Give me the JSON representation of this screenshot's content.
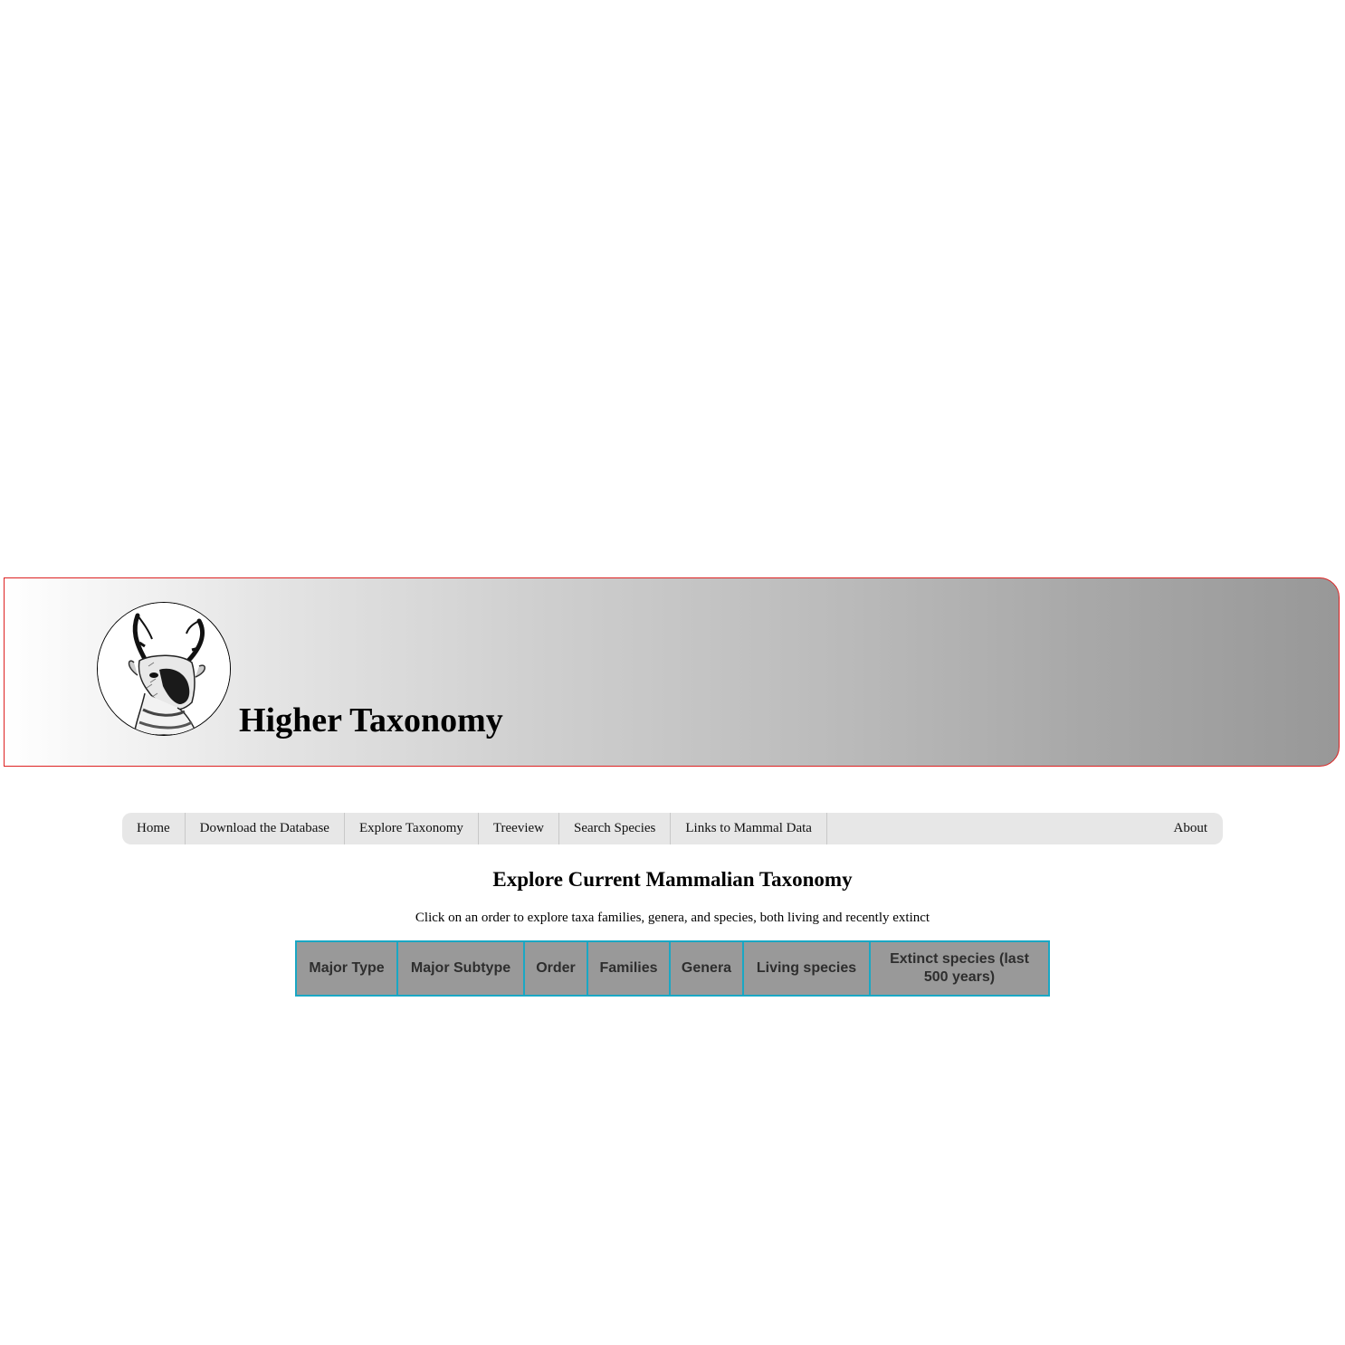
{
  "header": {
    "title": "Higher Taxonomy",
    "logo_icon": "pronghorn-antelope-logo-icon",
    "border_color": "#dd2222"
  },
  "nav": {
    "items": [
      {
        "label": "Home"
      },
      {
        "label": "Download the Database"
      },
      {
        "label": "Explore Taxonomy"
      },
      {
        "label": "Treeview"
      },
      {
        "label": "Search Species"
      },
      {
        "label": "Links to Mammal Data"
      }
    ],
    "right_item": {
      "label": "About"
    }
  },
  "main": {
    "heading": "Explore Current Mammalian Taxonomy",
    "subtext": "Click on an order to explore taxa families, genera, and species, both living and recently extinct",
    "table": {
      "border_color": "#1aa7c4",
      "header_bg": "#999999",
      "headers": [
        "Major Type",
        "Major Subtype",
        "Order",
        "Families",
        "Genera",
        "Living species",
        "Extinct species (last 500 years)"
      ],
      "rows": []
    }
  }
}
